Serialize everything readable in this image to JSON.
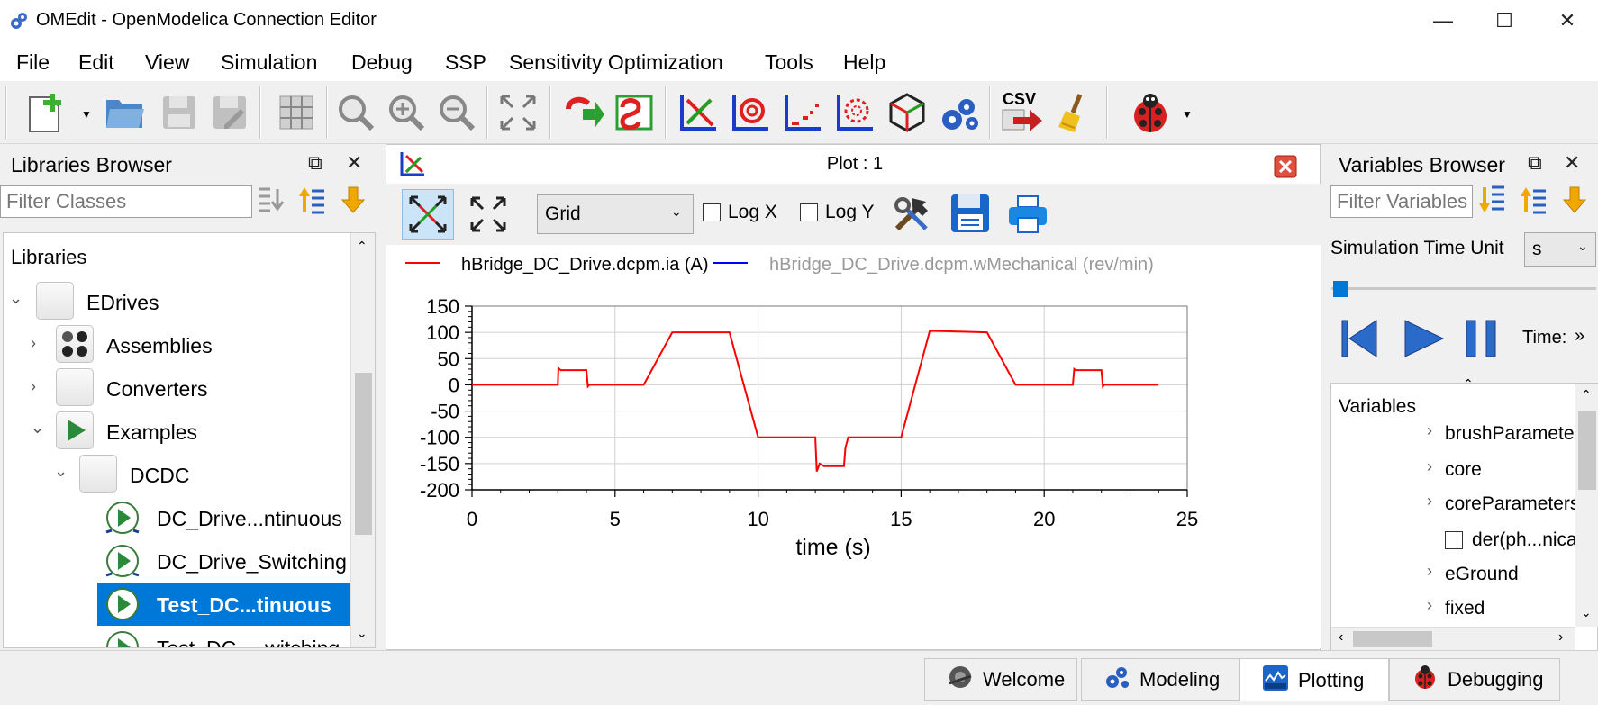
{
  "window": {
    "title": "OMEdit - OpenModelica Connection Editor"
  },
  "menu": [
    "File",
    "Edit",
    "View",
    "Simulation",
    "Debug",
    "SSP",
    "Sensitivity Optimization",
    "Tools",
    "Help"
  ],
  "toolbar": {
    "csv_label": "CSV"
  },
  "libraries": {
    "title": "Libraries Browser",
    "filter_placeholder": "Filter Classes",
    "header": "Libraries",
    "items": [
      {
        "label": "EDrives"
      },
      {
        "label": "Assemblies"
      },
      {
        "label": "Converters"
      },
      {
        "label": "Examples"
      },
      {
        "label": "DCDC"
      },
      {
        "label": "DC_Drive...ntinuous"
      },
      {
        "label": "DC_Drive_Switching"
      },
      {
        "label": "Test_DC...tinuous"
      },
      {
        "label": "Test_DC_...witching"
      }
    ]
  },
  "plot": {
    "window_title": "Plot : 1",
    "grid_select": "Grid",
    "log_x": "Log X",
    "log_y": "Log Y"
  },
  "variables": {
    "title": "Variables Browser",
    "filter_placeholder": "Filter Variables",
    "time_unit_label": "Simulation Time Unit",
    "time_unit": "s",
    "time_label": "Time:",
    "header": "Variables",
    "items": [
      "brushParamete",
      "core",
      "coreParameters",
      "der(ph...nica",
      "eGround",
      "fixed"
    ]
  },
  "perspectives": [
    "Welcome",
    "Modeling",
    "Plotting",
    "Debugging"
  ],
  "colors": {
    "accent": "#0078d7",
    "series1": "#ff0000",
    "series2": "#0000ff"
  },
  "chart_data": {
    "type": "line",
    "xlabel": "time (s)",
    "ylabel": "",
    "xlim": [
      0,
      25
    ],
    "ylim": [
      -200,
      150
    ],
    "xticks": [
      0,
      5,
      10,
      15,
      20,
      25
    ],
    "yticks": [
      150,
      100,
      50,
      0,
      -50,
      -100,
      -150,
      -200
    ],
    "grid": true,
    "legend_position": "top",
    "series": [
      {
        "name": "hBridge_DC_Drive.dcpm.ia (A)",
        "color": "#ff0000",
        "x": [
          0,
          3.0,
          3.02,
          3.1,
          4.0,
          4.05,
          4.1,
          6.0,
          7.0,
          9.0,
          10.0,
          12.0,
          12.05,
          12.15,
          12.3,
          13.0,
          13.05,
          13.15,
          14.0,
          15.0,
          16.0,
          18.0,
          19.0,
          21.0,
          21.05,
          21.1,
          22.0,
          22.05,
          22.1,
          24.0
        ],
        "y": [
          0,
          0,
          32,
          28,
          28,
          -3,
          0,
          0,
          100,
          100,
          -100,
          -100,
          -165,
          -150,
          -155,
          -155,
          -120,
          -100,
          -100,
          -100,
          103,
          100,
          0,
          0,
          30,
          28,
          28,
          -3,
          0,
          0
        ]
      },
      {
        "name": "hBridge_DC_Drive.dcpm.wMechanical (rev/min)",
        "color": "#0000ff",
        "x": [],
        "y": []
      }
    ]
  }
}
